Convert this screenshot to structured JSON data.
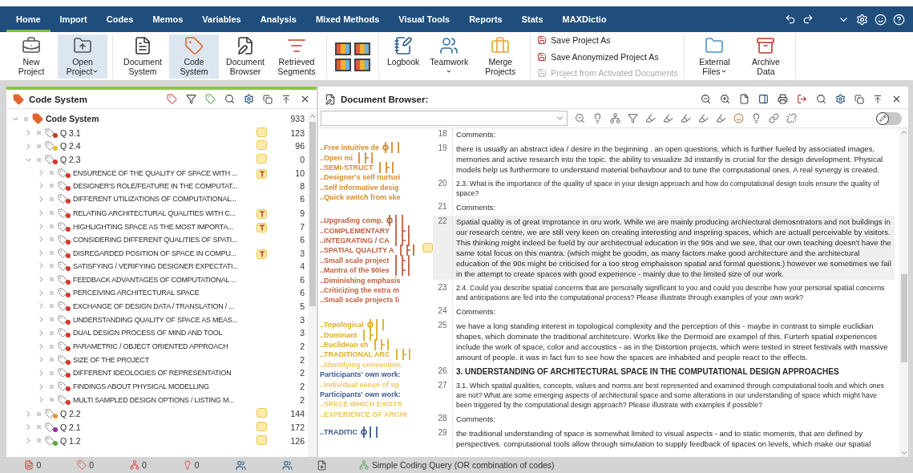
{
  "menu_bar": {
    "tabs": [
      {
        "label": "Home",
        "selected": true
      },
      {
        "label": "Import",
        "selected": false
      },
      {
        "label": "Codes",
        "selected": false
      },
      {
        "label": "Memos",
        "selected": false
      },
      {
        "label": "Variables",
        "selected": false
      },
      {
        "label": "Analysis",
        "selected": false
      },
      {
        "label": "Mixed Methods",
        "selected": false
      },
      {
        "label": "Visual Tools",
        "selected": false
      },
      {
        "label": "Reports",
        "selected": false
      },
      {
        "label": "Stats",
        "selected": false
      },
      {
        "label": "MAXDictio",
        "selected": false
      }
    ]
  },
  "ribbon": {
    "groups": [
      {
        "kind": "large",
        "items": [
          {
            "label": "New Project",
            "dropdown": false,
            "selected": false
          },
          {
            "label": "Open Project",
            "dropdown": true,
            "selected": true
          }
        ]
      },
      {
        "kind": "large",
        "items": [
          {
            "label": "Document System",
            "dropdown": false,
            "selected": false
          },
          {
            "label": "Code System",
            "dropdown": false,
            "selected": true
          },
          {
            "label": "Document Browser",
            "dropdown": false,
            "selected": false
          },
          {
            "label": "Retrieved Segments",
            "dropdown": false,
            "selected": false
          }
        ]
      },
      {
        "kind": "layouts"
      },
      {
        "kind": "large",
        "items": [
          {
            "label": "Logbook",
            "dropdown": false,
            "selected": false
          },
          {
            "label": "Teamwork",
            "dropdown": true,
            "selected": false
          },
          {
            "label": "Merge Projects",
            "dropdown": false,
            "selected": false
          }
        ]
      },
      {
        "kind": "small",
        "items": [
          {
            "label": "Save Project As",
            "disabled": false
          },
          {
            "label": "Save Anonymized Project As",
            "disabled": false
          },
          {
            "label": "Project from Activated Documents",
            "disabled": true
          }
        ]
      },
      {
        "kind": "large",
        "items": [
          {
            "label": "External Files",
            "dropdown": true,
            "selected": false
          },
          {
            "label": "Archive Data",
            "dropdown": false,
            "selected": false
          }
        ]
      }
    ]
  },
  "code_system": {
    "title": "Code System",
    "active": true,
    "tree": {
      "label": "Code System",
      "count": "933",
      "expanded": true,
      "children": [
        {
          "label": "Q 3.1",
          "color": "#b5432a",
          "memo": {
            "kind": "note"
          },
          "count": "123",
          "expanded": false
        },
        {
          "label": "Q 2.4",
          "color": "#e8c22c",
          "memo": {
            "kind": "note"
          },
          "count": "96",
          "expanded": false
        },
        {
          "label": "Q 2.3",
          "color": "#d8352a",
          "memo": {
            "kind": "note"
          },
          "count": "0",
          "expanded": true,
          "children": [
            {
              "label": "ENSURENCE OF THE QUALITY OF SPACE WITH ...",
              "color": "#d8352a",
              "memo": {
                "kind": "text"
              },
              "count": "10",
              "expanded": false
            },
            {
              "label": "DESIGNER'S ROLE/FEATURE IN THE COMPUTAT...",
              "color": "#d8352a",
              "count": "8",
              "expanded": false
            },
            {
              "label": "DIFFERENT UTILIZATIONS OF COMPUTATIONAL...",
              "color": "#d8352a",
              "count": "6",
              "expanded": false
            },
            {
              "label": "RELATING ARCHITECTURAL QUALITIES WITH C...",
              "color": "#d8352a",
              "memo": {
                "kind": "text"
              },
              "count": "9",
              "expanded": false
            },
            {
              "label": "HIGHLIGHTING SPACE AS THE MOST IMPORTA...",
              "color": "#d8352a",
              "memo": {
                "kind": "text"
              },
              "count": "7",
              "expanded": false
            },
            {
              "label": "CONSIDERING DIFFERENT QUALITIES OF SPATI...",
              "color": "#d8352a",
              "count": "6",
              "expanded": false
            },
            {
              "label": "DISREGARDED POSITION OF SPACE IN COMPU...",
              "color": "#d8352a",
              "memo": {
                "kind": "text"
              },
              "count": "3",
              "expanded": false
            },
            {
              "label": "SATISFYING /  VERIFYING DESIGNER EXPECTATI...",
              "color": "#d8352a",
              "count": "4",
              "expanded": false
            },
            {
              "label": "FEEDBACK ADVANTAGES OF COMPUTATIONAL ...",
              "color": "#d8352a",
              "count": "6",
              "expanded": false
            },
            {
              "label": "PERCEIVING ARCHITECTURAL SPACE",
              "color": "#d8352a",
              "count": "6",
              "expanded": false
            },
            {
              "label": "EXCHANGE OF DESIGN DATA / TRANSLATION / ...",
              "color": "#d8352a",
              "count": "5",
              "expanded": false
            },
            {
              "label": "UNDERSTANDING QUALITY OF SPACE AS MEAS...",
              "color": "#d8352a",
              "count": "3",
              "expanded": false
            },
            {
              "label": "DUAL DESIGN PROCESS OF MIND AND TOOL",
              "color": "#d8352a",
              "count": "3",
              "expanded": false
            },
            {
              "label": "PARAMETRIC / OBJECT ORIENTED APPROACH",
              "color": "#d8352a",
              "count": "2",
              "expanded": false
            },
            {
              "label": "SIZE OF THE PROJECT",
              "color": "#d8352a",
              "count": "2",
              "expanded": false
            },
            {
              "label": "DIFFERENT IDEOLOGIES OF REPRESENTATION",
              "color": "#d8352a",
              "count": "2",
              "expanded": false
            },
            {
              "label": "FINDINGS ABOUT PHYSICAL MODELLING",
              "color": "#d8352a",
              "count": "2",
              "expanded": false
            },
            {
              "label": "MULTI SAMPLED DESIGN OPTIONS / LISTING M...",
              "color": "#d8352a",
              "count": "2",
              "expanded": false
            }
          ]
        },
        {
          "label": "Q 2.2",
          "color": "#e8962c",
          "memo": {
            "kind": "note"
          },
          "count": "144",
          "expanded": false
        },
        {
          "label": "Q 2.1",
          "color": "#8e2c9a",
          "memo": {
            "kind": "note"
          },
          "count": "172",
          "expanded": false
        },
        {
          "label": "Q 1.2",
          "color": "#5aa83c",
          "memo": {
            "kind": "note"
          },
          "count": "126",
          "expanded": false
        }
      ]
    }
  },
  "document_browser": {
    "title": "Document Browser:",
    "edit_mode": false,
    "paragraphs": [
      {
        "number": "18",
        "kind": "body",
        "text": "Comments:",
        "highlighted": false,
        "memo": false
      },
      {
        "number": "19",
        "kind": "body",
        "text": "there is usually an abstract idea / desire in the beginning . an open questions, which is further fueled by associated images, memories and active research into the topic. the ability to visualize 3d instantly is crucial for the design development. Physical models help us furthermore to understand material behavbour and to tune the computational ones. A real synergy is created.",
        "highlighted": false,
        "memo": false,
        "codings": [
          {
            "label": "..Free intuitive de",
            "color": "#d98a2b",
            "stripe": true
          },
          {
            "label": "..Open mi",
            "color": "#d98a2b",
            "stripe": true
          },
          {
            "label": "..SEMI-STRUCT",
            "color": "#d98a2b",
            "stripe": true
          },
          {
            "label": "..Designer's self nurturi",
            "color": "#d98a2b",
            "stripe": false
          },
          {
            "label": "..Self informative desig",
            "color": "#d98a2b",
            "stripe": false
          },
          {
            "label": "..Quick switch from ske",
            "color": "#d98a2b",
            "stripe": false
          }
        ]
      },
      {
        "number": "20",
        "kind": "question",
        "text": "2.3. What is the importance of the quality of space in your design approach and how do computational design tools ensure the quality of space?",
        "highlighted": false,
        "memo": false
      },
      {
        "number": "21",
        "kind": "body",
        "text": "Comments:",
        "highlighted": false,
        "memo": false
      },
      {
        "number": "22",
        "kind": "body",
        "text": "Spatial quality is of great improtance in oru work. While we are mainly producing archiectural demosntrators and not buildings in our research centre, we are still very keen on creating interesting and inspriing spaces, which are actuall perceivable by visitors. This thinking might indeed be fueld by our architectrual education in the 90s and we see, that our own teaching doesn't have the same total focus on this mantra. (which might be goodm, as many factors make good architecture and the architectural education of the 90s might be criticised for a too strog emphaisson spatial and formal questions.) however we sometimes we fail in the attempt to create spaces with good experience - mainly due to the limited size of our work.",
        "highlighted": true,
        "memo": true,
        "codings": [
          {
            "label": "..Upgrading comp.",
            "color": "#c0603f",
            "stripe": true
          },
          {
            "label": "..COMPLEMENTARY",
            "color": "#c0603f",
            "stripe": true
          },
          {
            "label": "..INTEGRATING / CA",
            "color": "#c0603f",
            "stripe": true
          },
          {
            "label": "..SPATIAL QUALITY A",
            "color": "#c0603f",
            "stripe": true
          },
          {
            "label": "..Small scale project",
            "color": "#c0603f",
            "stripe": true
          },
          {
            "label": "..Mantra of the 90ies",
            "color": "#c0603f",
            "stripe": true
          },
          {
            "label": "..Diminishing emphasis",
            "color": "#c0603f",
            "stripe": false
          },
          {
            "label": "..Criticizing the extra m",
            "color": "#c0603f",
            "stripe": false
          },
          {
            "label": "..Small scale projects li",
            "color": "#c0603f",
            "stripe": false
          }
        ]
      },
      {
        "number": "23",
        "kind": "question",
        "text": "2.4. Could you describe spatial concerns that are personally significant to you and could you describe how your personal spatial concerns and anticipations are fed into the computational process? Please illustrate through examples of your own work?",
        "highlighted": false,
        "memo": false
      },
      {
        "number": "24",
        "kind": "body",
        "text": "Comments:",
        "highlighted": false,
        "memo": false
      },
      {
        "number": "25",
        "kind": "body",
        "text": "we have a long standing interest in topological complexity and the perception of this - maybe in contrast to simple euclidian shapes, which dominate the traditional architetcure. Works like the Dermoid are exampel of this. Furterh spatial experiences include the work of space, color and accoustics - as in the Distortion projects, which were tested in street festivals with massive amount of people. it was in fact fun to see how the spaces are inhabited and people react to the effects.",
        "highlighted": false,
        "memo": false,
        "codings": [
          {
            "label": "..Topological",
            "color": "#dcae25",
            "stripe": true
          },
          {
            "label": "..Dominant",
            "color": "#dcae25",
            "stripe": true
          },
          {
            "label": "..Euclidean sh",
            "color": "#dcae25",
            "stripe": true
          },
          {
            "label": "..TRADITIONAL ARC",
            "color": "#dcae25",
            "stripe": true
          },
          {
            "label": "..Identifying convention",
            "color": "#eec95e",
            "stripe": false
          },
          {
            "label": "Participants' own work:",
            "color": "#3d5b8f",
            "stripe": false
          },
          {
            "label": "..Individual sense of sp",
            "color": "#eec95e",
            "stripe": false
          },
          {
            "label": "Participants' own work:",
            "color": "#3d5b8f",
            "stripe": false
          },
          {
            "label": "..SPACE WHICH EXISTS",
            "color": "#eec95e",
            "stripe": false
          },
          {
            "label": "..EXPERIENCE OF ARCHI",
            "color": "#eec95e",
            "stripe": false
          }
        ]
      },
      {
        "number": "26",
        "kind": "heading",
        "text": "3. UNDERSTANDING OF ARCHITECTURAL SPACE IN THE COMPUTATIONAL DESIGN APPROACHES",
        "highlighted": false,
        "memo": false
      },
      {
        "number": "27",
        "kind": "question",
        "text": "3.1. Which spatial qualities, concepts, values and norms are best represented and examined through computational tools and which ones are not? What are some emerging aspects of architectural space and some alterations in our understanding of space which might have been triggered by the computational design approach? Please illustrate with examples if possible?",
        "highlighted": false,
        "memo": false
      },
      {
        "number": "28",
        "kind": "body",
        "text": "Comments:",
        "highlighted": false,
        "memo": false
      },
      {
        "number": "29",
        "kind": "body",
        "text": "the traditional understanding of space is somewhat limited to visual aspects - and to static moments, that are defined by perspectives. computational tools allow through simulation to supply feedback of spaces on levels, which make our spatial",
        "highlighted": false,
        "memo": false,
        "codings": [
          {
            "label": "..TRADITIC",
            "color": "#3d5b8f",
            "stripe": true
          }
        ]
      }
    ]
  },
  "status_bar": {
    "counters": [
      "0",
      "0",
      "0",
      "0"
    ],
    "query": "Simple Coding Query (OR combination of codes)"
  }
}
